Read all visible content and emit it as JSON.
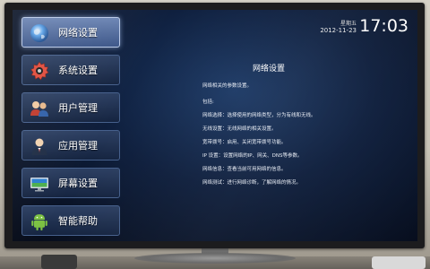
{
  "menu": {
    "items": [
      {
        "label": "网络设置",
        "icon": "globe-icon",
        "active": true
      },
      {
        "label": "系统设置",
        "icon": "gear-icon",
        "active": false
      },
      {
        "label": "用户管理",
        "icon": "users-icon",
        "active": false
      },
      {
        "label": "应用管理",
        "icon": "user-icon",
        "active": false
      },
      {
        "label": "屏幕设置",
        "icon": "monitor-icon",
        "active": false
      },
      {
        "label": "智能帮助",
        "icon": "android-icon",
        "active": false
      }
    ]
  },
  "clock": {
    "weekday": "星期五",
    "date": "2012-11-23",
    "time": "17:03"
  },
  "content": {
    "title": "网络设置",
    "lines": [
      "网络相关的参数设置。",
      "包括:",
      "网络选择：选择使用的网络类型，分为有线和无线。",
      "无线设置：无线网络的相关设置。",
      "宽带拨号：启用、关闭宽带拨号功能。",
      "IP 设置：设置网络的IP、网关、DNS等参数。",
      "网络信息：查看当前可用网络的信息。",
      "网络测试：进行网络诊断，了解网络的情况。"
    ]
  }
}
